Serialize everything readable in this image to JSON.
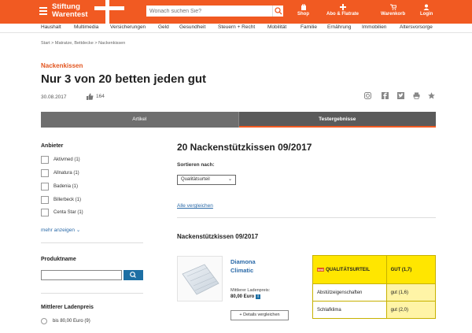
{
  "topbar": {
    "brand_line1": "Stiftung",
    "brand_line2": "Warentest",
    "search_placeholder": "Wonach suchen Sie?",
    "items": [
      {
        "label": "Shop",
        "icon": "shopping-bag-icon"
      },
      {
        "label": "Abo & Flatrate",
        "icon": "plus-icon"
      },
      {
        "label": "Warenkorb",
        "icon": "cart-icon"
      },
      {
        "label": "Login",
        "icon": "user-icon"
      }
    ]
  },
  "nav": {
    "items": [
      "Haushalt",
      "Multimedia",
      "Versicherungen",
      "Geld",
      "Gesundheit",
      "Steuern + Recht",
      "Mobilität",
      "Familie",
      "Ernährung",
      "Immobilien",
      "Altersvorsorge"
    ]
  },
  "breadcrumb": "Start  >  Matratze, Bettdecke  >  Nackenkissen",
  "article": {
    "kicker": "Nackenkissen",
    "title": "Nur 3 von 20 betten jeden gut",
    "date": "30.08.2017",
    "likes": "164"
  },
  "tabs": [
    "Artikel",
    "Testergebnisse"
  ],
  "sidebar": {
    "brand_heading": "Anbieter",
    "brands": [
      "Aktivmed (1)",
      "Allnatura (1)",
      "Badenia (1)",
      "Billerbeck (1)",
      "Centa Star (1)"
    ],
    "more_label": "mehr anzeigen",
    "product_heading": "Produktname",
    "price_heading": "Mittlerer Ladenpreis",
    "price_option": "bis 80,00 Euro (9)"
  },
  "main": {
    "heading": "20 Nackenstützkissen 09/2017",
    "sort_label": "Sortieren nach:",
    "sort_value": "Qualitätsurteil",
    "compare_all": "Alle vergleichen",
    "sub_heading": "Nackenstützkissen 09/2017"
  },
  "product": {
    "name_line1": "Diamona",
    "name_line2": "Climatic",
    "price_label": "Mittlerer Ladenpreis:",
    "price": "80,00 Euro",
    "price_badge": "i",
    "details_button": "+ Details vergleichen",
    "logo_badge": "test",
    "ratings": [
      {
        "label": "QUALITÄTSURTEIL",
        "value": "GUT (1,7)"
      },
      {
        "label": "Abstützeigenschaften",
        "value": "gut (1,6)"
      },
      {
        "label": "Schlafklima",
        "value": "gut (2,0)"
      }
    ]
  },
  "colors": {
    "brand": "#f15a22",
    "accent_blue": "#1d6fa4",
    "rating_yellow": "#ffe600"
  }
}
